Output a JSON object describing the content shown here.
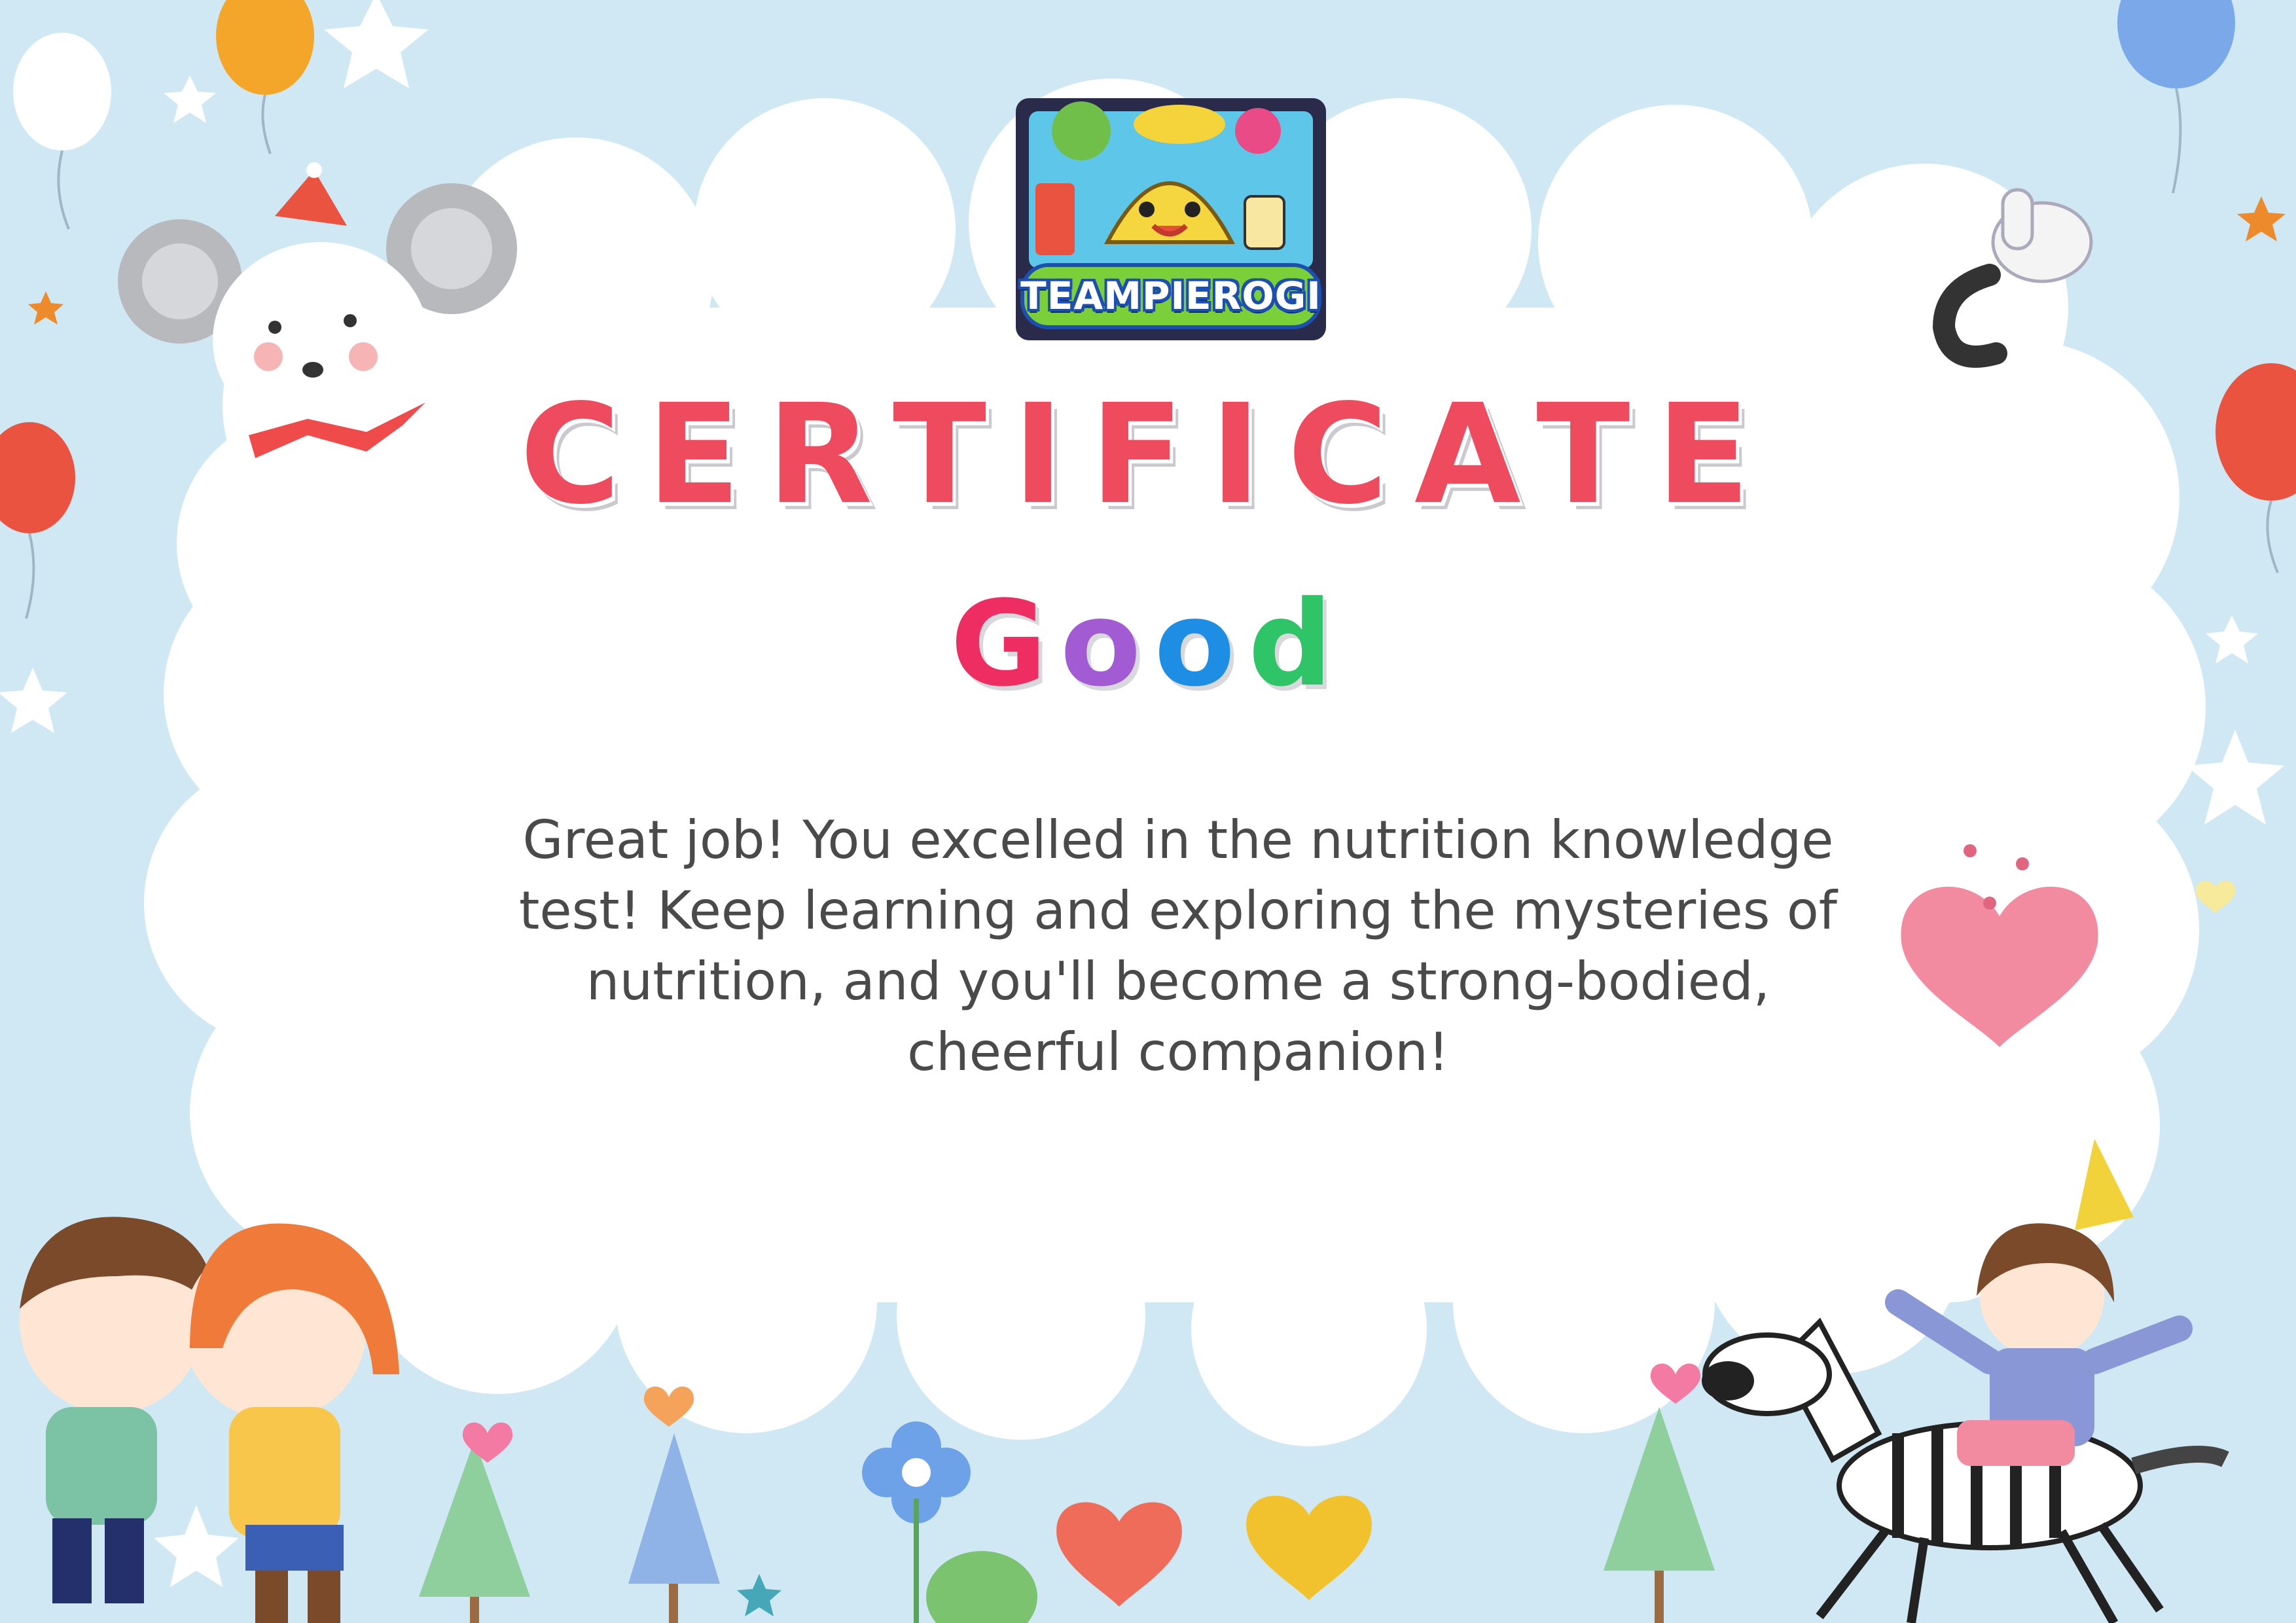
{
  "logo": {
    "text": "TEAMPIEROGI"
  },
  "certificate": {
    "title": "CERTIFICATE",
    "grade_letters": [
      "G",
      "o",
      "o",
      "d"
    ],
    "message": "Great job! You excelled in the nutrition knowledge test! Keep learning and exploring the mysteries of nutrition, and you'll become a strong-bodied, cheerful companion!"
  },
  "colors": {
    "background": "#cfe8f3",
    "cloud": "#ffffff",
    "title": "#ef4b5e",
    "grade": [
      "#ee2e63",
      "#a35bd4",
      "#1d8ee3",
      "#2fc468"
    ],
    "message": "#4a4a4a"
  },
  "icons": [
    "balloon-icon",
    "star-icon",
    "mouse-mascot-icon",
    "thumbs-up-icon",
    "heart-icon",
    "children-hugging-icon",
    "girl-on-zebra-icon",
    "tree-icon",
    "flower-icon"
  ]
}
